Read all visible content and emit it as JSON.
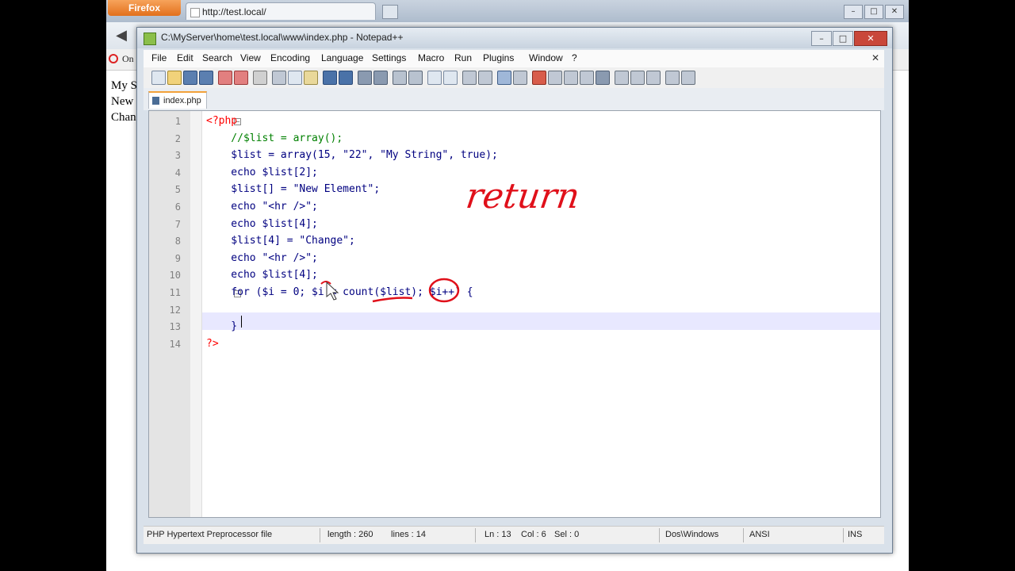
{
  "firefox": {
    "button_label": "Firefox",
    "tab_title": "http://test.local/",
    "bookmark_text": "On",
    "page_lines": [
      "My S",
      "New",
      "Chan"
    ]
  },
  "notepad": {
    "title": "C:\\MyServer\\home\\test.local\\www\\index.php - Notepad++",
    "menu": [
      "File",
      "Edit",
      "Search",
      "View",
      "Encoding",
      "Language",
      "Settings",
      "Macro",
      "Run",
      "Plugins",
      "Window",
      "?"
    ],
    "tab_label": "index.php",
    "line_numbers": [
      "1",
      "2",
      "3",
      "4",
      "5",
      "6",
      "7",
      "8",
      "9",
      "10",
      "11",
      "12",
      "13",
      "14"
    ],
    "code_lines": [
      "<?php",
      "    //$list = array();",
      "    $list = array(15, \"22\", \"My String\", true);",
      "    echo $list[2];",
      "    $list[] = \"New Element\";",
      "    echo \"<hr />\";",
      "    echo $list[4];",
      "    $list[4] = \"Change\";",
      "    echo \"<hr />\";",
      "    echo $list[4];",
      "    for ($i = 0; $i < count($list); $i++) {",
      "        ",
      "    }",
      "?>"
    ],
    "status": {
      "file_type": "PHP Hypertext Preprocessor file",
      "length": "length : 260",
      "lines": "lines : 14",
      "ln": "Ln : 13",
      "col": "Col : 6",
      "sel": "Sel : 0",
      "eol": "Dos\\Windows",
      "encoding": "ANSI",
      "mode": "INS"
    }
  },
  "annotation": {
    "text": "return",
    "color": "#e0101a"
  }
}
